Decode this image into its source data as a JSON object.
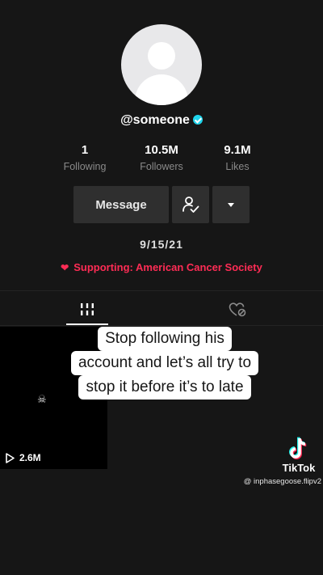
{
  "profile": {
    "username": "@someone",
    "verified": true,
    "stats": [
      {
        "value": "1",
        "label": "Following"
      },
      {
        "value": "10.5M",
        "label": "Followers"
      },
      {
        "value": "9.1M",
        "label": "Likes"
      }
    ],
    "bio": "9/15/21",
    "charity": "Supporting: American Cancer Society"
  },
  "actions": {
    "message_label": "Message",
    "follow_icon": "user-check-icon",
    "more_icon": "caret-down-icon"
  },
  "tabs": {
    "videos_icon": "grid-icon",
    "liked_icon": "liked-heart-icon"
  },
  "videos": [
    {
      "views": "2.6M"
    }
  ],
  "overlay": {
    "caption_lines": [
      "Stop following his",
      "account and let’s all try to",
      "stop it before it’s to late"
    ]
  },
  "watermark": {
    "brand": "TikTok",
    "user": "@ inphasegoose.flipv2"
  },
  "colors": {
    "background": "#161616",
    "accent": "#fe2c55",
    "verified": "#20d5ec"
  }
}
